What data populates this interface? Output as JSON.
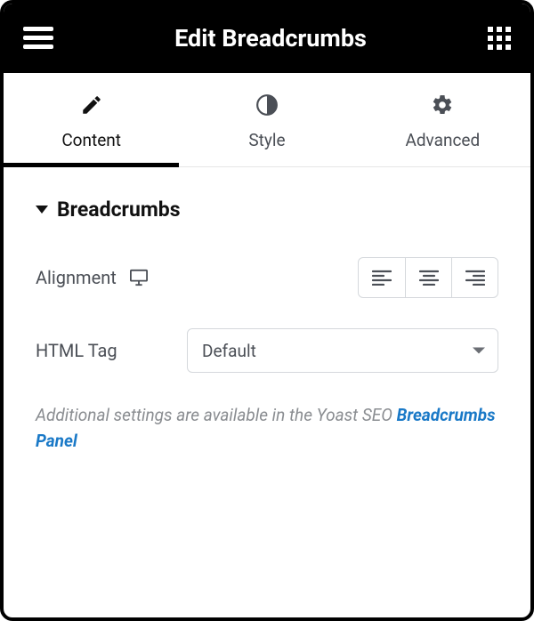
{
  "header": {
    "title": "Edit Breadcrumbs"
  },
  "tabs": [
    {
      "key": "content",
      "label": "Content",
      "active": true
    },
    {
      "key": "style",
      "label": "Style",
      "active": false
    },
    {
      "key": "advanced",
      "label": "Advanced",
      "active": false
    }
  ],
  "section": {
    "title": "Breadcrumbs",
    "expanded": true
  },
  "controls": {
    "alignment": {
      "label": "Alignment",
      "options": [
        "left",
        "center",
        "right"
      ]
    },
    "html_tag": {
      "label": "HTML Tag",
      "value": "Default"
    }
  },
  "note": {
    "prefix": "Additional settings are available in the Yoast SEO ",
    "link": "Breadcrumbs Panel"
  }
}
